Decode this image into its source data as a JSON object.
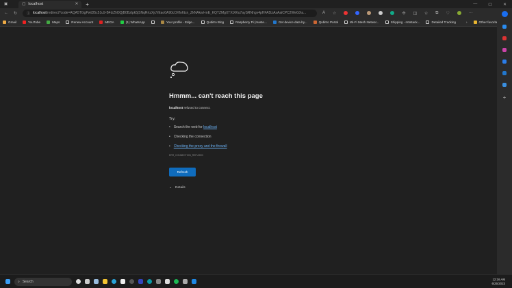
{
  "browser": {
    "tab_title": "localhost",
    "url_host": "localhost",
    "url_rest": "/redirect?code=AQA5TGgPwtD5c51u9-B4lzZN0QjB0BzIpk5jSNqRrtzXjcVEao0A90cOXfo6tcn_ZkNAkwl-mE_KQTZMgXTXtXKu7aySRNhgv4pHFA5LiAsAaiCPC2WeGXa...",
    "bookmarks": [
      "Gmail",
      "YouTube",
      "Maps",
      "Renew Account",
      "MEGA",
      "(1) WhatsApp",
      "",
      "Your profile - Edge...",
      "Qubitro Blog",
      "Raspberry Pi (maste...",
      "Get device data by...",
      "Qubitro Portal",
      "Wi-Fi Mesh Networ...",
      "Shipping - m5stack...",
      "Detailed Tracking"
    ],
    "other_favorites": "Other favorites"
  },
  "error": {
    "title": "Hmmm... can't reach this page",
    "host": "localhost",
    "refused": " refused to connect.",
    "try": "Try:",
    "search_prefix": "Search the web for ",
    "search_link": "localhost",
    "check_connection": "Checking the connection",
    "check_proxy": "Checking the proxy and the firewall",
    "code": "ERR_CONNECTION_REFUSED",
    "refresh": "Refresh",
    "details": "Details"
  },
  "taskbar": {
    "search": "Search",
    "time": "12:16 AM",
    "date": "6/25/2023"
  },
  "colors": {
    "accent": "#0f6cbd",
    "link": "#6ab0f3"
  }
}
